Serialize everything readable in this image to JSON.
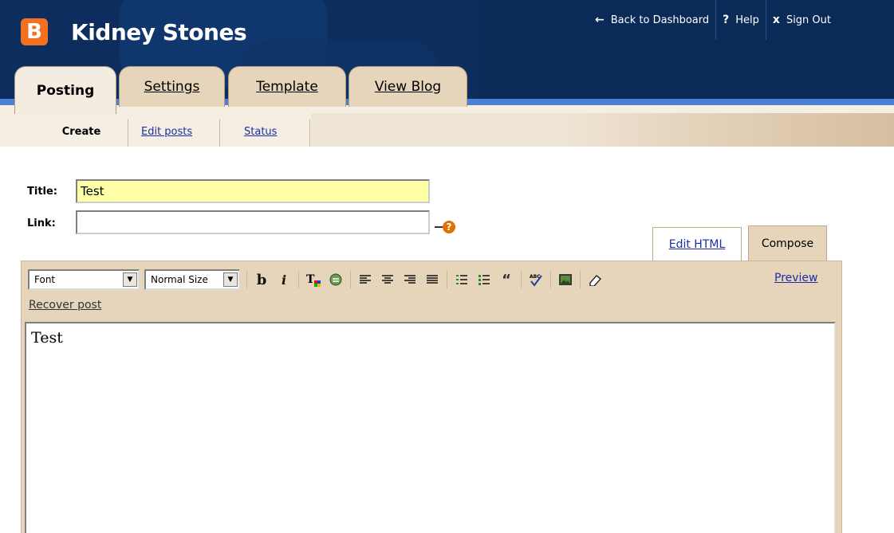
{
  "header": {
    "logo_letter": "B",
    "blog_title": "Kidney Stones",
    "links": [
      {
        "icon": "←",
        "label": "Back to Dashboard",
        "icon_name": "left-arrow-icon"
      },
      {
        "icon": "?",
        "label": "Help",
        "icon_name": "help-icon"
      },
      {
        "icon": "x",
        "label": "Sign Out",
        "icon_name": "close-icon"
      }
    ]
  },
  "tabs": [
    {
      "label": "Posting",
      "active": true
    },
    {
      "label": "Settings",
      "active": false
    },
    {
      "label": "Template",
      "active": false
    },
    {
      "label": "View Blog",
      "active": false
    }
  ],
  "subnav": [
    {
      "label": "Create",
      "active": true
    },
    {
      "label": "Edit posts",
      "active": false
    },
    {
      "label": "Status",
      "active": false
    }
  ],
  "form": {
    "title_label": "Title:",
    "title_value": "Test",
    "link_label": "Link:",
    "link_value": "",
    "help_symbol": "?"
  },
  "editor_tabs": [
    {
      "label": "Edit HTML",
      "active": false
    },
    {
      "label": "Compose",
      "active": true
    }
  ],
  "toolbar": {
    "font_value": "Font",
    "size_value": "Normal Size",
    "preview_label": "Preview",
    "recover_label": "Recover post",
    "icons": [
      "bold-icon",
      "italic-icon",
      "text-color-icon",
      "link-icon",
      "align-left-icon",
      "align-center-icon",
      "align-right-icon",
      "justify-icon",
      "numbered-list-icon",
      "bulleted-list-icon",
      "blockquote-icon",
      "spellcheck-icon",
      "image-icon",
      "eraser-icon"
    ]
  },
  "editor_body": "Test",
  "colors": {
    "header_bg": "#0c2d5e",
    "accent_blue": "#4d7fd3",
    "tab_bg": "#e6d5bb",
    "logo_orange": "#f37021",
    "title_field_bg": "#ffffa8",
    "link_blue": "#1b2ea8"
  }
}
